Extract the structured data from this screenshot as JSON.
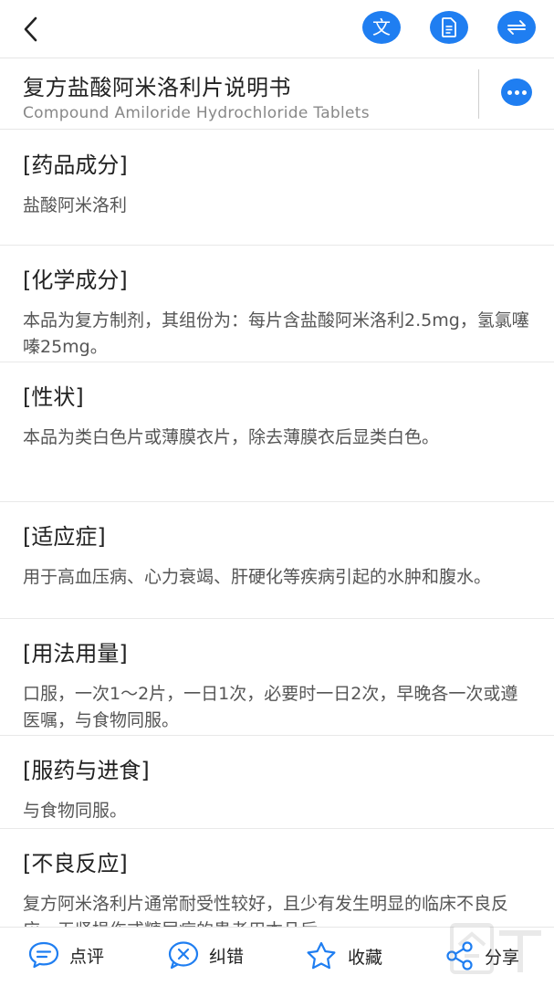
{
  "topbar": {
    "icons": [
      "back-arrow-icon",
      "translate-icon",
      "document-icon",
      "swap-icon"
    ],
    "translate_label": "文",
    "accent_color": "#1f7ef1"
  },
  "drug": {
    "title_cn": "复方盐酸阿米洛利片说明书",
    "title_en": "Compound Amiloride Hydrochloride Tablets"
  },
  "sections": [
    {
      "title": "[药品成分]",
      "body": "盐酸阿米洛利"
    },
    {
      "title": "[化学成分]",
      "body": "本品为复方制剂，其组份为：每片含盐酸阿米洛利2.5mg，氢氯噻嗪25mg。"
    },
    {
      "title": "[性状]",
      "body": "本品为类白色片或薄膜衣片，除去薄膜衣后显类白色。"
    },
    {
      "title": "[适应症]",
      "body": "用于高血压病、心力衰竭、肝硬化等疾病引起的水肿和腹水。"
    },
    {
      "title": "[用法用量]",
      "body": "口服，一次1～2片，一日1次，必要时一日2次，早晚各一次或遵医嘱，与食物同服。"
    },
    {
      "title": "[服药与进食]",
      "body": "与食物同服。"
    },
    {
      "title": "[不良反应]",
      "body": "复方阿米洛利片通常耐受性较好，且少有发生明显的临床不良反应，无肾损伤或糖尿病的患者用本品后"
    }
  ],
  "bottombar": {
    "comment_label": "点评",
    "correct_label": "纠错",
    "favorite_label": "收藏",
    "share_label": "分享"
  }
}
